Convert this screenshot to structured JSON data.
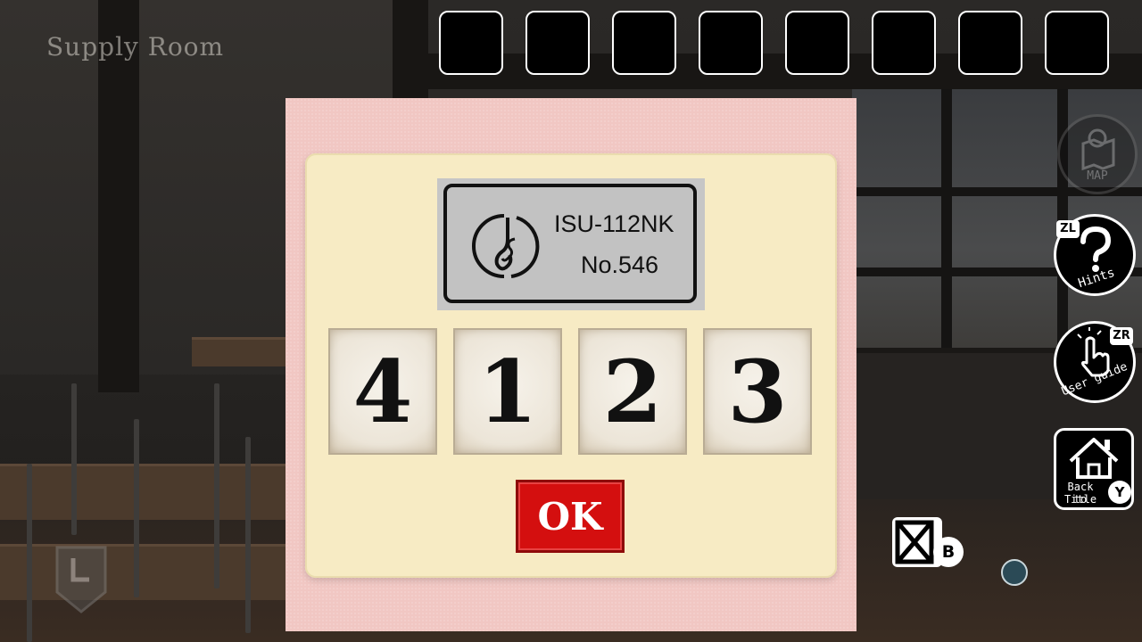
{
  "room": {
    "title": "Supply Room"
  },
  "inventory": {
    "slots": [
      "",
      "",
      "",
      "",
      "",
      "",
      "",
      ""
    ]
  },
  "side_buttons": {
    "map": {
      "label": "MAP",
      "enabled": false
    },
    "hints": {
      "label": "Hints",
      "key": "ZL"
    },
    "user_guide": {
      "label": "User guide",
      "key": "ZR"
    },
    "back_to_title": {
      "label_line1": "Back to",
      "label_line2": "Title",
      "key": "Y"
    }
  },
  "close": {
    "key": "B"
  },
  "lock": {
    "model": "ISU-112NK",
    "number": "No.546",
    "digits": [
      "4",
      "1",
      "2",
      "3"
    ],
    "ok_label": "OK"
  },
  "colors": {
    "frame": "#f1c7c3",
    "panel": "#f7ebc4",
    "ok_button": "#d40f0f"
  }
}
